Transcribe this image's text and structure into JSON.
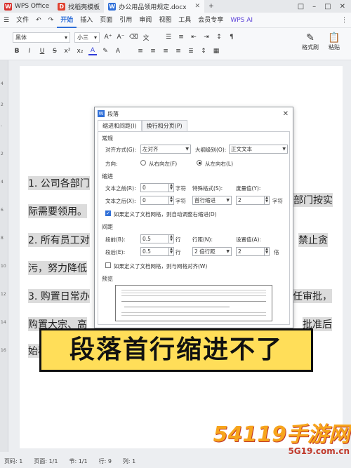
{
  "titlebar": {
    "tabs": [
      {
        "label": "WPS Office",
        "icon": "wps-logo-icon"
      },
      {
        "label": "找稻壳模板",
        "icon": "docer-icon"
      },
      {
        "label": "办公用品领用规定.docx",
        "icon": "word-doc-icon"
      }
    ],
    "add_tab": "+",
    "controls": [
      "□",
      "–",
      "□",
      "✕"
    ]
  },
  "menubar": {
    "file": "文件",
    "items": [
      "开始",
      "插入",
      "页面",
      "引用",
      "审阅",
      "视图",
      "工具",
      "会员专享"
    ],
    "active": "开始",
    "ai": "WPS AI"
  },
  "ribbon": {
    "font": "黑体",
    "size": "小三",
    "format_brush": "格式刷",
    "paste": "粘贴"
  },
  "document": {
    "lines": [
      "1. 公司各部门",
      "部门按实",
      "际需要领用。",
      "2. 所有员工对",
      "禁止贪",
      "污，努力降低",
      "3. 购置日常办",
      "任审批，",
      "购置大宗、高",
      "批准后",
      "始程"
    ]
  },
  "dialog": {
    "title": "段落",
    "tabs": [
      "缩进和间距(I)",
      "换行和分页(P)"
    ],
    "general": {
      "section": "常规",
      "align_label": "对齐方式(G):",
      "align_value": "左对齐",
      "outline_label": "大纲级别(O):",
      "outline_value": "正文文本",
      "direction_label": "方向:",
      "rtl": "从右向左(F)",
      "ltr": "从左向右(L)"
    },
    "indent": {
      "section": "缩进",
      "before_label": "文本之前(R):",
      "before_value": "0",
      "before_unit": "字符",
      "special_label": "特殊格式(S):",
      "special_value": "首行缩进",
      "measure_label": "度量值(Y):",
      "measure_value": "2",
      "measure_unit": "字符",
      "after_label": "文本之后(X):",
      "after_value": "0",
      "after_unit": "字符",
      "grid_check": "如果定义了文档网格，则自动调整右缩进(D)"
    },
    "spacing": {
      "section": "间距",
      "before_label": "段前(B):",
      "before_value": "0.5",
      "before_unit": "行",
      "line_label": "行距(N):",
      "line_value": "2 倍行距",
      "set_label": "设置值(A):",
      "set_value": "2",
      "set_unit": "倍",
      "after_label": "段后(E):",
      "after_value": "0.5",
      "after_unit": "行",
      "grid_check": "如果定义了文档网格，则与网格对齐(W)"
    },
    "preview_label": "预览"
  },
  "caption": "段落首行缩进不了",
  "statusbar": {
    "page": "页码: 1",
    "pages": "页面: 1/1",
    "section": "节: 1/1",
    "line": "行: 9",
    "column": "列: 1"
  },
  "watermark": {
    "main": "54119手游网",
    "sub": "5G19.com.cn"
  }
}
